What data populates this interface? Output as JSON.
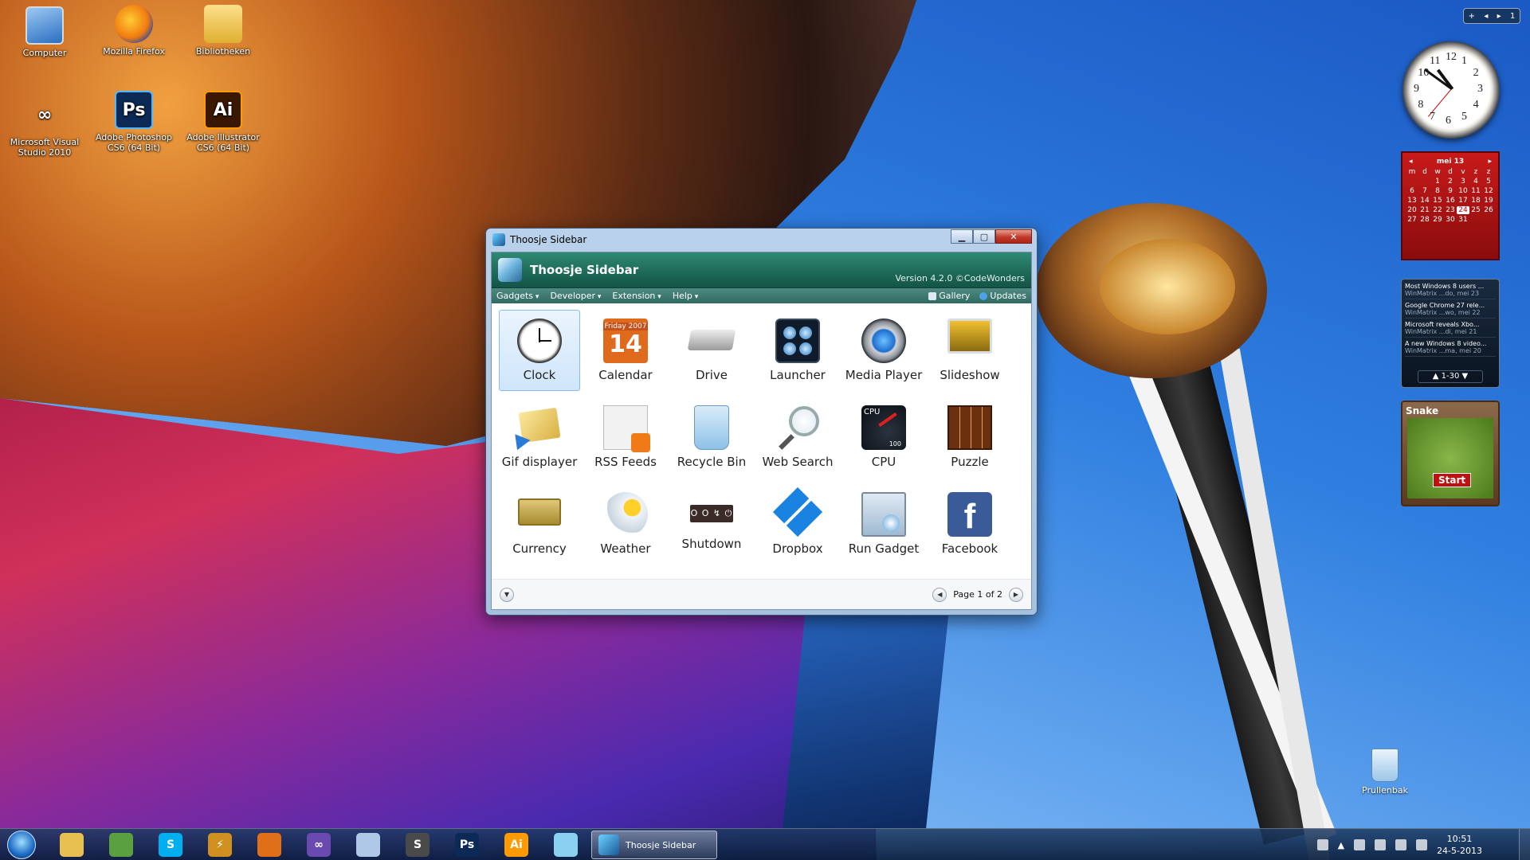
{
  "desktop": {
    "icons": [
      {
        "label": "Computer",
        "icon": "computer-icon"
      },
      {
        "label": "Mozilla Firefox",
        "icon": "firefox-icon"
      },
      {
        "label": "Bibliotheken",
        "icon": "library-folder-icon"
      },
      {
        "label": "Microsoft Visual Studio 2010",
        "icon": "visual-studio-icon"
      },
      {
        "label": "Adobe Photoshop CS6 (64 Bit)",
        "icon": "photoshop-icon",
        "glyph": "Ps"
      },
      {
        "label": "Adobe Illustrator CS6 (64 Bit)",
        "icon": "illustrator-icon",
        "glyph": "Ai"
      }
    ],
    "recycle_bin": {
      "label": "Prullenbak"
    }
  },
  "window": {
    "title": "Thoosje Sidebar",
    "header_title": "Thoosje Sidebar",
    "version": "Version 4.2.0 ©CodeWonders",
    "menu": [
      "Gadgets",
      "Developer",
      "Extension",
      "Help"
    ],
    "menu_right": {
      "gallery": "Gallery",
      "updates": "Updates"
    },
    "gadgets": [
      {
        "label": "Clock",
        "icon": "clock-icon",
        "selected": true
      },
      {
        "label": "Calendar",
        "icon": "calendar-icon",
        "cal_top": "Friday 2007",
        "cal_num": "14"
      },
      {
        "label": "Drive",
        "icon": "drive-icon"
      },
      {
        "label": "Launcher",
        "icon": "launcher-icon"
      },
      {
        "label": "Media Player",
        "icon": "media-player-icon"
      },
      {
        "label": "Slideshow",
        "icon": "slideshow-icon"
      },
      {
        "label": "Gif displayer",
        "icon": "gif-displayer-icon"
      },
      {
        "label": "RSS Feeds",
        "icon": "rss-icon"
      },
      {
        "label": "Recycle Bin",
        "icon": "recycle-bin-icon"
      },
      {
        "label": "Web Search",
        "icon": "magnifier-icon"
      },
      {
        "label": "CPU",
        "icon": "cpu-meter-icon",
        "cpu_label": "CPU",
        "cpu_max": "100"
      },
      {
        "label": "Puzzle",
        "icon": "puzzle-icon"
      },
      {
        "label": "Currency",
        "icon": "currency-icon"
      },
      {
        "label": "Weather",
        "icon": "weather-icon"
      },
      {
        "label": "Shutdown",
        "icon": "shutdown-icon",
        "glyph": "O O ↯ ⏻"
      },
      {
        "label": "Dropbox",
        "icon": "dropbox-icon"
      },
      {
        "label": "Run Gadget",
        "icon": "run-gadget-icon"
      },
      {
        "label": "Facebook",
        "icon": "facebook-icon",
        "glyph": "f"
      }
    ],
    "pager": {
      "text": "Page 1 of 2"
    }
  },
  "gadgets_panel": {
    "topbar": [
      "+",
      "◂",
      "▸",
      "1"
    ],
    "clock_numbers": [
      "12",
      "1",
      "2",
      "3",
      "4",
      "5",
      "6",
      "7",
      "8",
      "9",
      "10",
      "11"
    ],
    "calendar": {
      "month": "mei 13",
      "weekdays": [
        "m",
        "d",
        "w",
        "d",
        "v",
        "z",
        "z"
      ],
      "days": [
        "",
        "",
        "1",
        "2",
        "3",
        "4",
        "5",
        "6",
        "7",
        "8",
        "9",
        "10",
        "11",
        "12",
        "13",
        "14",
        "15",
        "16",
        "17",
        "18",
        "19",
        "20",
        "21",
        "22",
        "23",
        "24",
        "25",
        "26",
        "27",
        "28",
        "29",
        "30",
        "31"
      ],
      "today": "24"
    },
    "news": {
      "items": [
        {
          "title": "Most Windows 8 users ...",
          "sub": "WinMatrix ...do, mei 23"
        },
        {
          "title": "Google Chrome 27 rele...",
          "sub": "WinMatrix ...wo, mei 22"
        },
        {
          "title": "Microsoft reveals Xbo...",
          "sub": "WinMatrix ...di, mei 21"
        },
        {
          "title": "A new Windows 8 video...",
          "sub": "WinMatrix ...ma, mei 20"
        }
      ],
      "range": "1-30"
    },
    "snake": {
      "title": "Snake",
      "start": "Start"
    }
  },
  "taskbar": {
    "pinned": [
      {
        "icon": "explorer-icon",
        "glyph": "",
        "color": "#e8c050"
      },
      {
        "icon": "notepad-plus-icon",
        "glyph": "",
        "color": "#5aa040"
      },
      {
        "icon": "skype-icon",
        "glyph": "S",
        "color": "#00aff0"
      },
      {
        "icon": "winamp-icon",
        "glyph": "⚡",
        "color": "#d09020"
      },
      {
        "icon": "firefox-icon",
        "glyph": "",
        "color": "#e07018"
      },
      {
        "icon": "visual-studio-icon",
        "glyph": "∞",
        "color": "#6a4ab0"
      },
      {
        "icon": "virtualbox-icon",
        "glyph": "",
        "color": "#b0c8e8"
      },
      {
        "icon": "sublime-text-icon",
        "glyph": "S",
        "color": "#4a4a4a"
      },
      {
        "icon": "photoshop-icon",
        "glyph": "Ps",
        "color": "#0b2a55"
      },
      {
        "icon": "illustrator-icon",
        "glyph": "Ai",
        "color": "#ff9a00"
      },
      {
        "icon": "notes-icon",
        "glyph": "",
        "color": "#8ad0f0"
      }
    ],
    "running": {
      "label": "Thoosje Sidebar"
    },
    "clock": {
      "time": "10:51",
      "date": "24-5-2013"
    }
  }
}
